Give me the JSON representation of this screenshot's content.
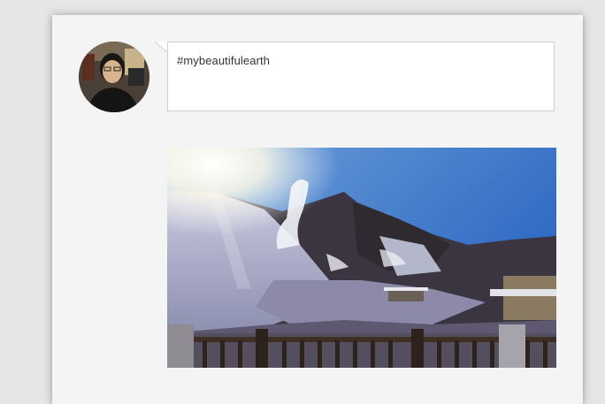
{
  "post": {
    "text": "#mybeautifulearth",
    "author_avatar": "user-avatar-photo",
    "photo": "mountain-steam-landscape-photo"
  },
  "colors": {
    "card_background": "#f4f4f4",
    "bubble_background": "#ffffff",
    "bubble_border": "#cfcfcf",
    "text": "#333333"
  }
}
